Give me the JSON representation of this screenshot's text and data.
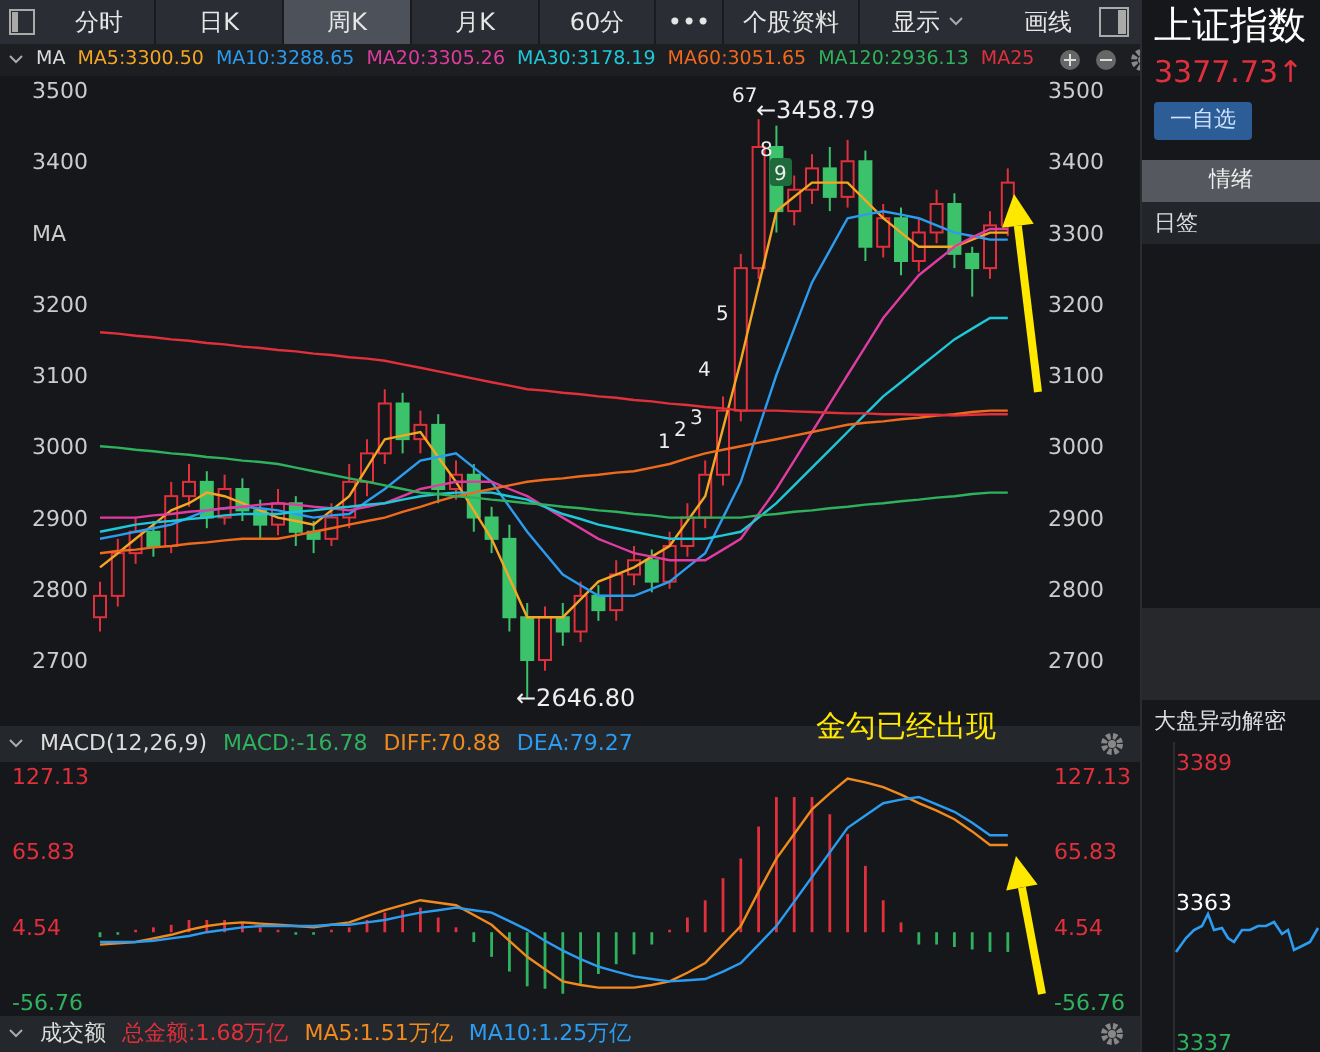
{
  "toolbar": {
    "tabs": [
      {
        "label": "分时",
        "selected": false
      },
      {
        "label": "日K",
        "selected": false
      },
      {
        "label": "周K",
        "selected": true
      },
      {
        "label": "月K",
        "selected": false
      },
      {
        "label": "60分",
        "selected": false
      }
    ],
    "more": "•••",
    "info": "个股资料",
    "display": "显示",
    "draw": "画线"
  },
  "ma_legend": {
    "label": "MA"
  },
  "price_chart": {
    "markers": [
      "1",
      "2",
      "3",
      "4",
      "5",
      "67",
      "8",
      "9"
    ],
    "high_label": "←3458.79",
    "low_label": "←2646.80",
    "candles": {
      "chart_data": {
        "type": "candlestick",
        "ylim": [
          2700,
          3500
        ],
        "yticks": [
          2700,
          2800,
          2900,
          3000,
          3100,
          3200,
          3300,
          3400,
          3500
        ],
        "ohlc": [
          [
            2760,
            2810,
            2740,
            2790
          ],
          [
            2790,
            2870,
            2775,
            2850
          ],
          [
            2850,
            2900,
            2835,
            2880
          ],
          [
            2880,
            2895,
            2845,
            2860
          ],
          [
            2860,
            2950,
            2850,
            2930
          ],
          [
            2930,
            2975,
            2915,
            2950
          ],
          [
            2950,
            2965,
            2885,
            2900
          ],
          [
            2900,
            2960,
            2890,
            2940
          ],
          [
            2940,
            2955,
            2895,
            2910
          ],
          [
            2910,
            2925,
            2870,
            2890
          ],
          [
            2890,
            2940,
            2875,
            2920
          ],
          [
            2920,
            2930,
            2860,
            2880
          ],
          [
            2880,
            2895,
            2850,
            2870
          ],
          [
            2870,
            2920,
            2860,
            2900
          ],
          [
            2900,
            2975,
            2885,
            2950
          ],
          [
            2950,
            3010,
            2930,
            2990
          ],
          [
            2990,
            3080,
            2975,
            3060
          ],
          [
            3060,
            3075,
            2990,
            3010
          ],
          [
            3010,
            3050,
            2990,
            3030
          ],
          [
            3030,
            3045,
            2920,
            2940
          ],
          [
            2940,
            2980,
            2925,
            2960
          ],
          [
            2960,
            2975,
            2880,
            2900
          ],
          [
            2900,
            2915,
            2850,
            2870
          ],
          [
            2870,
            2890,
            2740,
            2760
          ],
          [
            2760,
            2780,
            2647,
            2700
          ],
          [
            2700,
            2775,
            2685,
            2760
          ],
          [
            2760,
            2780,
            2720,
            2740
          ],
          [
            2740,
            2810,
            2725,
            2790
          ],
          [
            2790,
            2805,
            2755,
            2770
          ],
          [
            2770,
            2840,
            2755,
            2820
          ],
          [
            2820,
            2860,
            2805,
            2840
          ],
          [
            2840,
            2855,
            2795,
            2810
          ],
          [
            2810,
            2880,
            2800,
            2860
          ],
          [
            2860,
            2920,
            2845,
            2900
          ],
          [
            2900,
            2980,
            2885,
            2960
          ],
          [
            2960,
            3070,
            2945,
            3050
          ],
          [
            3050,
            3270,
            3035,
            3250
          ],
          [
            3250,
            3459,
            3235,
            3420
          ],
          [
            3420,
            3450,
            3300,
            3330
          ],
          [
            3330,
            3380,
            3310,
            3360
          ],
          [
            3360,
            3410,
            3340,
            3390
          ],
          [
            3390,
            3420,
            3330,
            3350
          ],
          [
            3350,
            3430,
            3335,
            3400
          ],
          [
            3400,
            3415,
            3260,
            3280
          ],
          [
            3280,
            3340,
            3265,
            3320
          ],
          [
            3320,
            3335,
            3240,
            3260
          ],
          [
            3260,
            3320,
            3245,
            3300
          ],
          [
            3300,
            3360,
            3285,
            3340
          ],
          [
            3340,
            3355,
            3250,
            3270
          ],
          [
            3270,
            3280,
            3210,
            3250
          ],
          [
            3250,
            3330,
            3235,
            3310
          ],
          [
            3310,
            3390,
            3295,
            3370
          ]
        ]
      }
    },
    "averages": {
      "chart_data": {
        "type": "line",
        "ylim": [
          2700,
          3500
        ],
        "yticks": [
          2700,
          2800,
          2900,
          3000,
          3100,
          3200,
          {
            "value": 3300,
            "label": "MA"
          },
          3400,
          3500
        ],
        "series": [
          {
            "name": "MA5:3300.50",
            "color": "#f5a623",
            "values": [
              2830,
              2850,
              2870,
              2890,
              2910,
              2920,
              2935,
              2930,
              2920,
              2910,
              2900,
              2895,
              2890,
              2910,
              2930,
              2970,
              3010,
              3015,
              3020,
              2985,
              2950,
              2910,
              2870,
              2815,
              2760,
              2760,
              2760,
              2785,
              2810,
              2820,
              2830,
              2845,
              2860,
              2895,
              2930,
              3025,
              3120,
              3225,
              3330,
              3350,
              3370,
              3370,
              3370,
              3345,
              3320,
              3300,
              3280,
              3280,
              3280,
              3290,
              3300,
              3300
            ]
          },
          {
            "name": "MA10:3288.65",
            "color": "#2b9cf0",
            "values": [
              2870,
              2875,
              2880,
              2885,
              2890,
              2900,
              2910,
              2913,
              2915,
              2913,
              2910,
              2905,
              2900,
              2903,
              2905,
              2923,
              2940,
              2960,
              2980,
              2985,
              2990,
              2970,
              2950,
              2915,
              2880,
              2850,
              2820,
              2805,
              2790,
              2790,
              2790,
              2800,
              2810,
              2830,
              2850,
              2900,
              2950,
              3025,
              3100,
              3165,
              3230,
              3275,
              3320,
              3325,
              3330,
              3325,
              3320,
              3310,
              3300,
              3295,
              3290,
              3290
            ]
          },
          {
            "name": "MA20:3305.26",
            "color": "#e03ca0",
            "values": [
              2900,
              2900,
              2900,
              2903,
              2905,
              2908,
              2910,
              2913,
              2915,
              2918,
              2920,
              2918,
              2915,
              2913,
              2910,
              2915,
              2920,
              2930,
              2940,
              2945,
              2950,
              2950,
              2950,
              2940,
              2930,
              2915,
              2900,
              2885,
              2870,
              2860,
              2850,
              2845,
              2840,
              2840,
              2840,
              2855,
              2870,
              2905,
              2940,
              2980,
              3020,
              3060,
              3100,
              3140,
              3180,
              3210,
              3240,
              3260,
              3280,
              3293,
              3305,
              3305
            ]
          },
          {
            "name": "MA30:3178.19",
            "color": "#1ec8d8",
            "values": [
              2880,
              2885,
              2890,
              2893,
              2895,
              2898,
              2900,
              2903,
              2905,
              2905,
              2905,
              2908,
              2910,
              2913,
              2915,
              2918,
              2920,
              2925,
              2930,
              2933,
              2935,
              2935,
              2935,
              2930,
              2925,
              2915,
              2905,
              2898,
              2890,
              2885,
              2880,
              2875,
              2870,
              2870,
              2870,
              2875,
              2880,
              2900,
              2920,
              2945,
              2970,
              2995,
              3020,
              3045,
              3070,
              3090,
              3110,
              3130,
              3150,
              3165,
              3180,
              3180
            ]
          },
          {
            "name": "MA60:3051.65",
            "color": "#f06a1e",
            "values": [
              2850,
              2853,
              2855,
              2858,
              2860,
              2863,
              2865,
              2868,
              2870,
              2870,
              2870,
              2875,
              2880,
              2885,
              2890,
              2895,
              2900,
              2908,
              2915,
              2923,
              2930,
              2935,
              2940,
              2945,
              2950,
              2953,
              2955,
              2958,
              2960,
              2963,
              2965,
              2970,
              2975,
              2983,
              2990,
              2995,
              3000,
              3005,
              3010,
              3015,
              3020,
              3025,
              3030,
              3033,
              3035,
              3038,
              3040,
              3043,
              3045,
              3048,
              3050,
              3050
            ]
          },
          {
            "name": "MA120:2936.13",
            "color": "#2fb25e",
            "values": [
              3000,
              2998,
              2995,
              2993,
              2990,
              2988,
              2985,
              2983,
              2980,
              2978,
              2975,
              2970,
              2965,
              2960,
              2955,
              2950,
              2945,
              2940,
              2935,
              2933,
              2930,
              2928,
              2925,
              2923,
              2920,
              2918,
              2915,
              2913,
              2910,
              2908,
              2905,
              2903,
              2900,
              2900,
              2900,
              2900,
              2900,
              2903,
              2905,
              2908,
              2910,
              2913,
              2915,
              2918,
              2920,
              2923,
              2925,
              2928,
              2930,
              2933,
              2935,
              2935
            ]
          },
          {
            "name": "MA25",
            "color": "#e0303c",
            "values": [
              3160,
              3158,
              3155,
              3153,
              3150,
              3148,
              3145,
              3143,
              3140,
              3138,
              3135,
              3133,
              3130,
              3128,
              3125,
              3123,
              3120,
              3115,
              3110,
              3105,
              3100,
              3095,
              3090,
              3085,
              3080,
              3078,
              3075,
              3073,
              3070,
              3068,
              3065,
              3063,
              3060,
              3058,
              3055,
              3053,
              3050,
              3050,
              3050,
              3049,
              3048,
              3047,
              3046,
              3046,
              3045,
              3045,
              3044,
              3044,
              3043,
              3044,
              3045,
              3045
            ]
          }
        ]
      }
    }
  },
  "annotation": "金勾已经出现",
  "macd": {
    "label": "MACD(12,26,9)",
    "histogram": {
      "chart_data": {
        "type": "bar",
        "ylim": [
          -56.76,
          127.13
        ],
        "yticks": [
          -56.76,
          4.54,
          65.83,
          127.13
        ],
        "series": [
          {
            "name": "MACD:-16.78",
            "color": "#2fb25e",
            "values": [
              -4,
              -2,
              null,
              null,
              null,
              null,
              null,
              null,
              null,
              null,
              null,
              -2,
              -2,
              null,
              null,
              null,
              null,
              null,
              null,
              null,
              null,
              -8,
              -20,
              -32,
              -44,
              -46,
              -50,
              -42,
              -34,
              -26,
              -18,
              -10,
              null,
              null,
              null,
              null,
              null,
              null,
              null,
              null,
              null,
              null,
              null,
              null,
              null,
              null,
              -10,
              -10,
              -12,
              -14,
              -16,
              -16
            ]
          },
          {
            "color": "#e0303c",
            "values": [
              null,
              null,
              2,
              4,
              6,
              10,
              10,
              10,
              8,
              4,
              2,
              null,
              null,
              2,
              4,
              10,
              16,
              18,
              20,
              12,
              4,
              null,
              null,
              null,
              null,
              null,
              null,
              null,
              null,
              null,
              null,
              null,
              2,
              12,
              26,
              44,
              60,
              86,
              110,
              110,
              110,
              96,
              80,
              54,
              26,
              8,
              null,
              null,
              null,
              null,
              null,
              null
            ]
          }
        ]
      }
    },
    "lines": {
      "chart_data": {
        "type": "line",
        "ylim": [
          -56.76,
          127.13
        ],
        "yticks": [
          -56.76,
          4.54,
          65.83,
          127.13
        ],
        "series": [
          {
            "name": "DIFF:70.88",
            "color": "#f08a1e",
            "values": [
              -10,
              -9,
              -8,
              -5,
              -2,
              2,
              5,
              7,
              8,
              7,
              6,
              5,
              4,
              6,
              8,
              13,
              18,
              22,
              26,
              24,
              22,
              14,
              6,
              -7,
              -20,
              -30,
              -40,
              -43,
              -45,
              -45,
              -45,
              -43,
              -40,
              -33,
              -25,
              -10,
              5,
              33,
              60,
              80,
              100,
              113,
              125,
              122,
              118,
              112,
              105,
              99,
              92,
              82,
              71,
              71
            ]
          },
          {
            "name": "DEA:79.27",
            "color": "#2b9cf0",
            "values": [
              -8,
              -8,
              -8,
              -7,
              -5,
              -3,
              0,
              2,
              4,
              5,
              5,
              5,
              5,
              6,
              6,
              8,
              10,
              13,
              16,
              18,
              20,
              18,
              16,
              9,
              2,
              -7,
              -15,
              -22,
              -28,
              -32,
              -36,
              -38,
              -40,
              -39,
              -38,
              -32,
              -25,
              -10,
              5,
              25,
              45,
              65,
              85,
              95,
              105,
              108,
              110,
              104,
              98,
              89,
              79,
              79
            ]
          }
        ]
      }
    }
  },
  "volume": {
    "label": "成交额",
    "items": [
      {
        "text": "总金额:1.68万亿",
        "color": "#e0303c"
      },
      {
        "text": "MA5:1.51万亿",
        "color": "#f08a1e"
      },
      {
        "text": "MA10:1.25万亿",
        "color": "#2b9cf0"
      }
    ]
  },
  "sidebar": {
    "title": "上证指数",
    "price": "3377.73↑",
    "watch_button": "一自选",
    "tabs": [
      {
        "label": "情绪",
        "selected": true
      }
    ],
    "daily_sign": "日签",
    "alert_title": "大盘异动解密",
    "mini_labels": [
      {
        "text": "3389",
        "color": "#e0303c"
      },
      {
        "text": "3363",
        "color": "#ffffff"
      },
      {
        "text": "3337",
        "color": "#2fb25e"
      }
    ]
  }
}
